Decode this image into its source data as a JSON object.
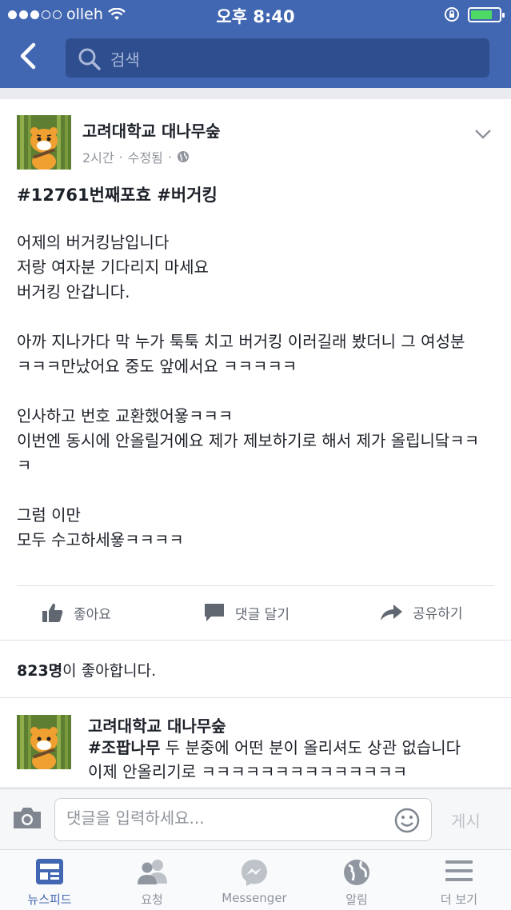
{
  "status_bar": {
    "carrier": "olleh",
    "time": "오후 8:40",
    "battery_level": 0.75
  },
  "header": {
    "search_placeholder": "검색"
  },
  "post": {
    "page_name": "고려대학교 대나무숲",
    "time_ago": "2시간",
    "edited": "수정됨",
    "hashtags": "#12761번째포효 #버거킹",
    "lines": [
      "어제의 버거킹남입니다",
      "저랑 여자분 기다리지 마세요",
      "버거킹 안갑니다.",
      "",
      "아까 지나가다 막 누가 툭툭 치고 버거킹 이러길래 봤더니 그 여성분",
      "ㅋㅋㅋ만났어요 중도 앞에서요 ㅋㅋㅋㅋㅋ",
      "",
      "인사하고 번호 교환했어욯ㅋㅋㅋ",
      "이번엔 동시에 안올릴거에요 제가 제보하기로 해서 제가 올립니닼ㅋㅋㅋ",
      "",
      "그럼 이만",
      "모두 수고하세욯ㅋㅋㅋㅋ"
    ],
    "actions": {
      "like": "좋아요",
      "comment": "댓글 달기",
      "share": "공유하기"
    },
    "likes_count": "823명",
    "likes_suffix": "이 좋아합니다."
  },
  "comment": {
    "author": "고려대학교 대나무숲",
    "tag": "#조팝나무",
    "text": " 두 분중에 어떤 분이 올리셔도 상관 없습니다",
    "text_cut": "이제 안올리기로 ㅋㅋㅋㅋㅋㅋㅋㅋㅋㅋㅋㅋㅋㅋ"
  },
  "comment_input": {
    "placeholder": "댓글을 입력하세요...",
    "post_label": "게시"
  },
  "tabbar": {
    "tabs": [
      {
        "label": "뉴스피드",
        "icon": "news-feed-icon"
      },
      {
        "label": "요청",
        "icon": "friend-requests-icon"
      },
      {
        "label": "Messenger",
        "icon": "messenger-icon"
      },
      {
        "label": "알림",
        "icon": "notifications-globe-icon"
      },
      {
        "label": "더 보기",
        "icon": "menu-icon"
      }
    ]
  },
  "colors": {
    "brand": "#4267b2",
    "active_tab": "#4267b2",
    "muted": "#90949c"
  }
}
